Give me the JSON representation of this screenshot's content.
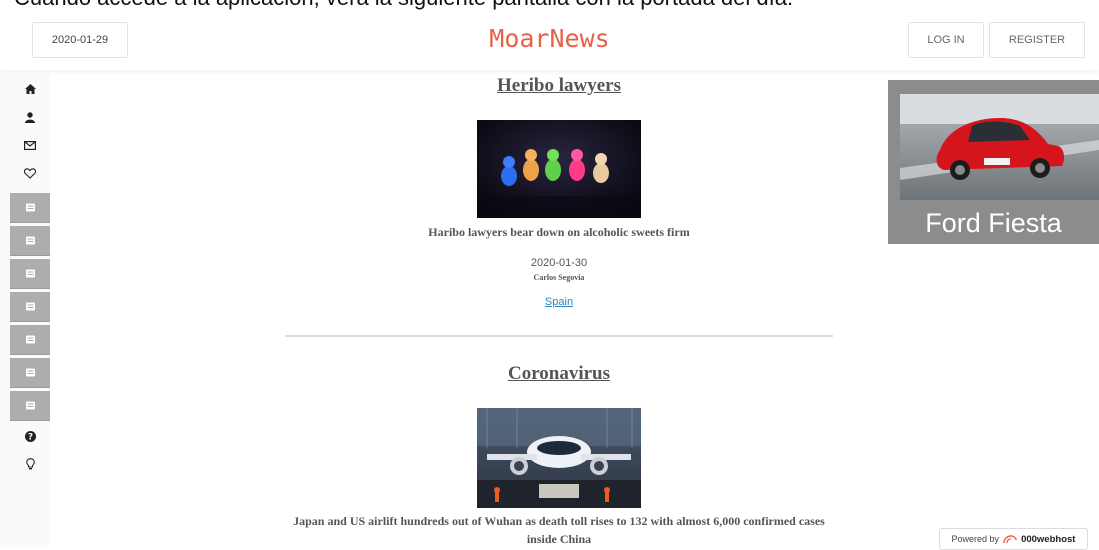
{
  "caption": "Cuando accede a la aplicación, verá la siguiente pantalla con la portada del día:",
  "header": {
    "date": "2020-01-29",
    "logo": "MoarNews",
    "login_label": "LOG IN",
    "register_label": "REGISTER"
  },
  "sidebar": {
    "top_icons": [
      "home-icon",
      "user-icon",
      "envelope-icon",
      "heart-icon"
    ],
    "section_icons": [
      "newspaper-icon",
      "newspaper-icon",
      "newspaper-icon",
      "newspaper-icon",
      "newspaper-icon",
      "newspaper-icon",
      "newspaper-icon"
    ],
    "bottom_icons": [
      "question-icon",
      "lightbulb-icon"
    ]
  },
  "articles": [
    {
      "title": "Heribo lawyers",
      "image": "gummy-bears-photo",
      "headline": "Haribo lawyers bear down on alcoholic sweets firm",
      "date": "2020-01-30",
      "author": "Carlos Segovia",
      "section": "Spain"
    },
    {
      "title": "Coronavirus",
      "image": "airplane-photo",
      "headline": "Japan and US airlift hundreds out of Wuhan as death toll rises to 132 with almost 6,000 confirmed cases inside China"
    }
  ],
  "ad": {
    "caption": "Ford Fiesta",
    "image": "red-car-photo"
  },
  "footer": {
    "powered_prefix": "Powered by",
    "powered_brand": "000webhost"
  },
  "colors": {
    "logo": "#e8604a",
    "link": "#2a86c6",
    "sidebar_section": "#adadad",
    "ad_background": "#8c8c8c"
  }
}
